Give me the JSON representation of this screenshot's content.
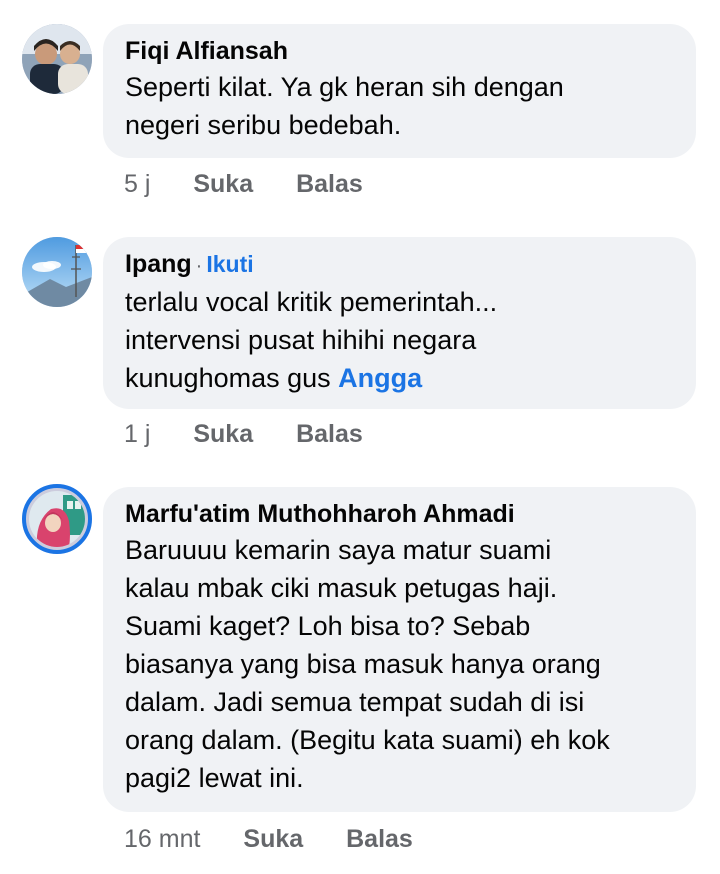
{
  "comments": [
    {
      "author": "Fiqi Alfiansah",
      "text": "Seperti kilat. Ya gk heran sih dengan\nnegeri seribu bedebah.",
      "time": "5 j",
      "like_label": "Suka",
      "reply_label": "Balas"
    },
    {
      "author": "Ipang",
      "separator": "·",
      "follow_label": "Ikuti",
      "text": "terlalu vocal kritik pemerintah...\nintervensi pusat hihihi negara\nkunughomas gus ",
      "mention": "Angga",
      "time": "1 j",
      "like_label": "Suka",
      "reply_label": "Balas"
    },
    {
      "author": "Marfu'atim Muthohharoh Ahmadi",
      "text": "Baruuuu kemarin saya matur suami\nkalau mbak ciki masuk petugas haji.\nSuami kaget? Loh bisa to? Sebab\nbiasanya yang bisa masuk hanya orang\ndalam. Jadi semua tempat sudah di isi\norang dalam. (Begitu kata suami) eh kok\npagi2 lewat ini.",
      "time": "16 mnt",
      "like_label": "Suka",
      "reply_label": "Balas"
    }
  ],
  "colors": {
    "bubble": "#f0f2f5",
    "link": "#1b74e4",
    "meta": "#65676b",
    "story_ring": "#1b74e4"
  }
}
